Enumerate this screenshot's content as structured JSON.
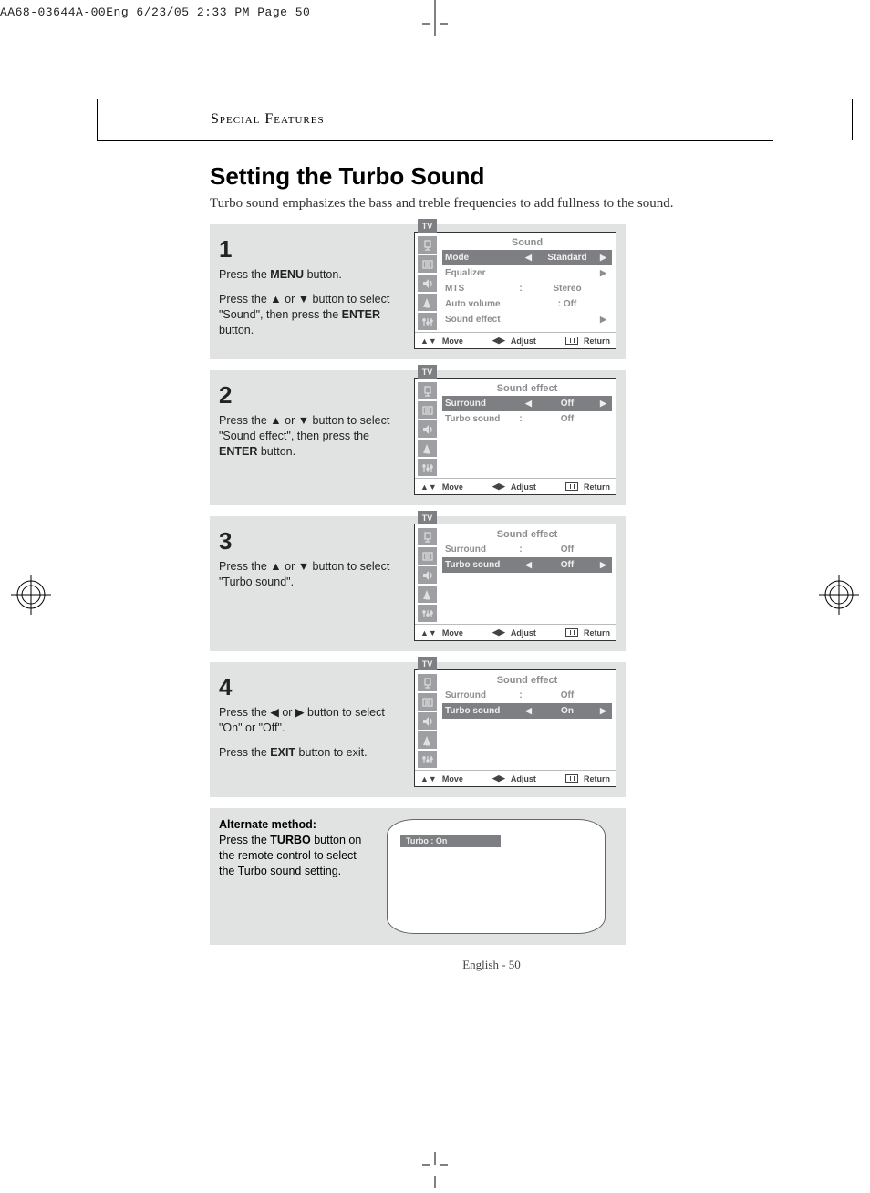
{
  "print_header": "AA68-03644A-00Eng  6/23/05  2:33 PM  Page 50",
  "section_header": "Special Features",
  "title": "Setting the Turbo Sound",
  "lead": "Turbo sound emphasizes the bass and treble frequencies to add fullness to the sound.",
  "page_number": "English - 50",
  "osd_footer": {
    "move": "Move",
    "adjust": "Adjust",
    "return": "Return"
  },
  "tv_badge": "TV",
  "steps": [
    {
      "num": "1",
      "paras": [
        {
          "pre": "Press the ",
          "bold": "MENU",
          "post": " button."
        },
        {
          "pre": "Press the ▲ or ▼ button to select \"Sound\", then press the ",
          "bold": "ENTER",
          "post": " button."
        }
      ],
      "osd": {
        "title": "Sound",
        "rows": [
          {
            "label": "Mode",
            "sep": "",
            "value": "Standard",
            "selected": true,
            "chev_l": "◀",
            "chev_r": "▶"
          },
          {
            "label": "Equalizer",
            "sep": "",
            "value": "",
            "chev_r": "▶"
          },
          {
            "label": "MTS",
            "sep": ":",
            "value": "Stereo"
          },
          {
            "label": "Auto volume",
            "sep": "",
            "value": ": Off"
          },
          {
            "label": "Sound effect",
            "sep": "",
            "value": "",
            "chev_r": "▶"
          }
        ]
      }
    },
    {
      "num": "2",
      "paras": [
        {
          "pre": "Press the ▲ or ▼ button to select \"Sound effect\", then press the ",
          "bold": "ENTER",
          "post": " button."
        }
      ],
      "osd": {
        "title": "Sound effect",
        "rows": [
          {
            "label": "Surround",
            "sep": "",
            "value": "Off",
            "selected": true,
            "chev_l": "◀",
            "chev_r": "▶"
          },
          {
            "label": "Turbo sound",
            "sep": ":",
            "value": "Off"
          }
        ]
      }
    },
    {
      "num": "3",
      "paras": [
        {
          "pre": "Press the ▲ or ▼ button to select \"Turbo sound\".",
          "bold": "",
          "post": ""
        }
      ],
      "osd": {
        "title": "Sound effect",
        "rows": [
          {
            "label": "Surround",
            "sep": ":",
            "value": "Off"
          },
          {
            "label": "Turbo sound",
            "sep": "",
            "value": "Off",
            "selected": true,
            "chev_l": "◀",
            "chev_r": "▶"
          }
        ]
      }
    },
    {
      "num": "4",
      "paras": [
        {
          "pre": "Press the ◀ or ▶ button to select \"On\" or \"Off\".",
          "bold": "",
          "post": ""
        },
        {
          "pre": "Press the ",
          "bold": "EXIT",
          "post": " button to exit."
        }
      ],
      "osd": {
        "title": "Sound effect",
        "rows": [
          {
            "label": "Surround",
            "sep": ":",
            "value": "Off"
          },
          {
            "label": "Turbo sound",
            "sep": "",
            "value": "On",
            "selected": true,
            "chev_l": "◀",
            "chev_r": "▶"
          }
        ]
      }
    }
  ],
  "alternate": {
    "title": "Alternate method:",
    "body_pre": "Press the ",
    "body_bold": "TURBO",
    "body_post": " button on the remote control to select the Turbo sound setting.",
    "banner": "Turbo : On"
  }
}
